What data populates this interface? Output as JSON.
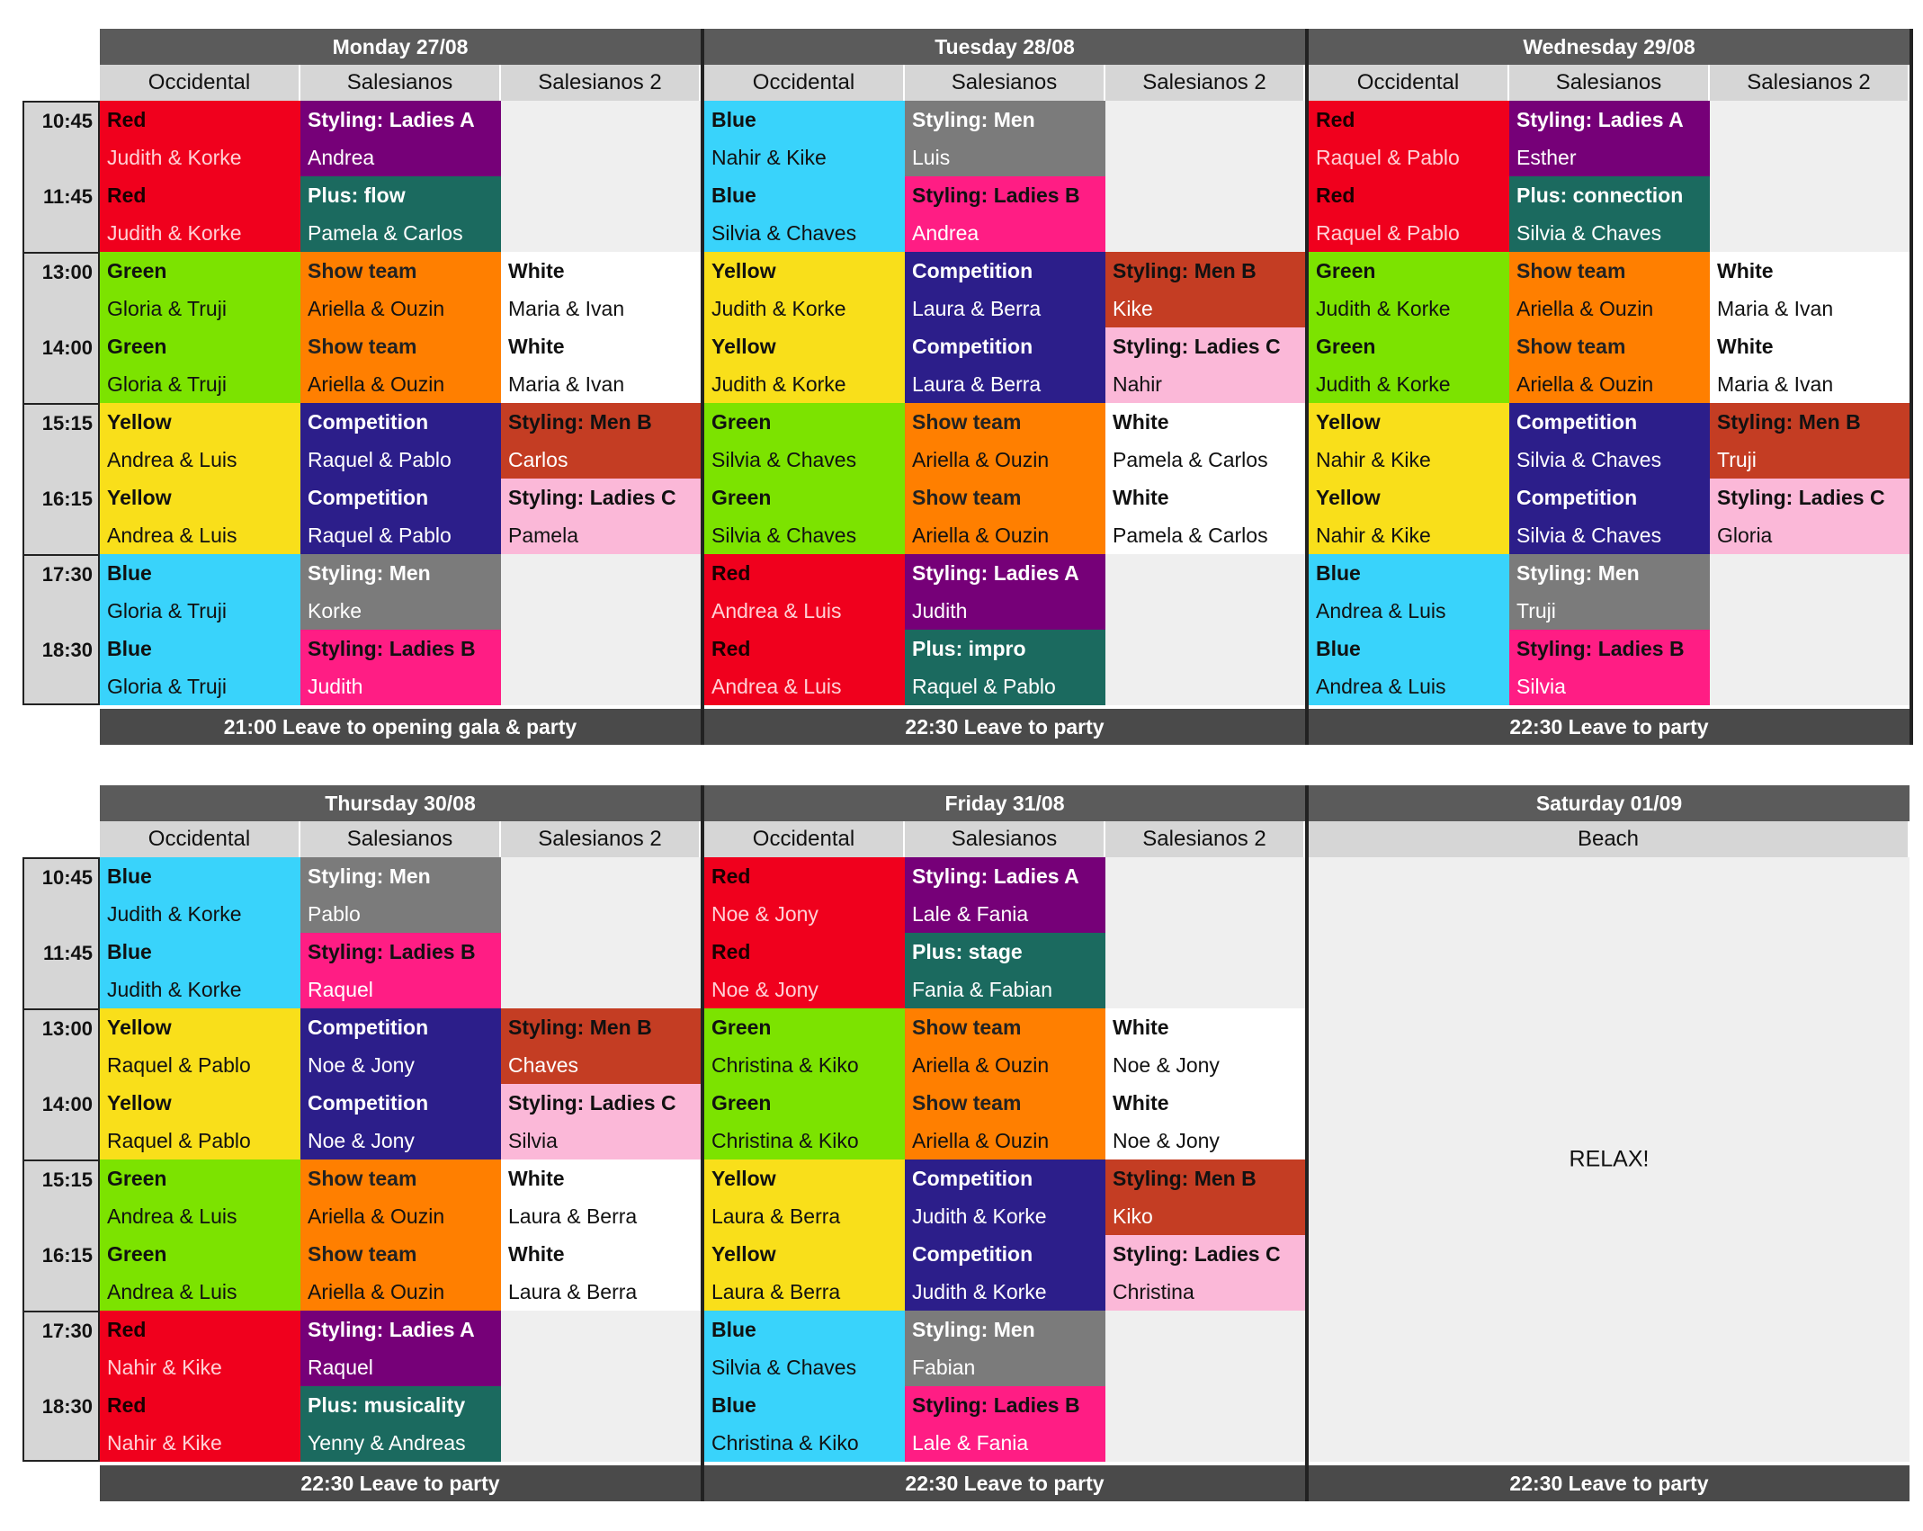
{
  "times": [
    "10:45",
    "11:45",
    "13:00",
    "14:00",
    "15:15",
    "16:15",
    "17:30",
    "18:30"
  ],
  "venues": [
    "Occidental",
    "Salesianos",
    "Salesianos 2"
  ],
  "colors": {
    "Red": "#f0001d",
    "Blue": "#39d3fb",
    "Green": "#7ce300",
    "Yellow": "#f9df1a",
    "Orange": "#ff7f00",
    "Navy": "#2c1e8a",
    "Gray": "#7b7b7b",
    "Purple": "#760078",
    "Teal": "#1b6a5f",
    "Pink": "#ff1d84",
    "LightPink": "#fbb8d8",
    "Brick": "#c43d23",
    "White": "#ffffff"
  },
  "week1": {
    "days": [
      {
        "title": "Monday 27/08",
        "footer": "21:00 Leave to opening gala & party",
        "cols": [
          [
            {
              "c": "Red",
              "t": "Red",
              "p": "Judith & Korke"
            },
            {
              "c": "Red",
              "t": "Red",
              "p": "Judith & Korke"
            },
            {
              "c": "Green",
              "t": "Green",
              "p": "Gloria & Truji"
            },
            {
              "c": "Green",
              "t": "Green",
              "p": "Gloria & Truji"
            },
            {
              "c": "Yellow",
              "t": "Yellow",
              "p": "Andrea & Luis"
            },
            {
              "c": "Yellow",
              "t": "Yellow",
              "p": "Andrea & Luis"
            },
            {
              "c": "Blue",
              "t": "Blue",
              "p": "Gloria & Truji"
            },
            {
              "c": "Blue",
              "t": "Blue",
              "p": "Gloria & Truji"
            }
          ],
          [
            {
              "c": "Purple",
              "t": "Styling: Ladies A",
              "p": "Andrea"
            },
            {
              "c": "Teal",
              "t": "Plus: flow",
              "p": "Pamela & Carlos"
            },
            {
              "c": "Orange",
              "t": "Show team",
              "p": "Ariella & Ouzin"
            },
            {
              "c": "Orange",
              "t": "Show team",
              "p": "Ariella & Ouzin"
            },
            {
              "c": "Navy",
              "t": "Competition",
              "p": "Raquel & Pablo"
            },
            {
              "c": "Navy",
              "t": "Competition",
              "p": "Raquel & Pablo"
            },
            {
              "c": "Gray",
              "t": "Styling: Men",
              "p": "Korke"
            },
            {
              "c": "Pink",
              "t": "Styling: Ladies B",
              "p": "Judith"
            }
          ],
          [
            null,
            null,
            {
              "c": "White",
              "t": "White",
              "p": "Maria & Ivan"
            },
            {
              "c": "White",
              "t": "White",
              "p": "Maria & Ivan"
            },
            {
              "c": "Brick",
              "t": "Styling: Men B",
              "p": "Carlos"
            },
            {
              "c": "LightPink",
              "t": "Styling: Ladies C",
              "p": "Pamela"
            },
            null,
            null
          ]
        ]
      },
      {
        "title": "Tuesday 28/08",
        "footer": "22:30 Leave to party",
        "cols": [
          [
            {
              "c": "Blue",
              "t": "Blue",
              "p": "Nahir & Kike"
            },
            {
              "c": "Blue",
              "t": "Blue",
              "p": "Silvia & Chaves"
            },
            {
              "c": "Yellow",
              "t": "Yellow",
              "p": "Judith & Korke"
            },
            {
              "c": "Yellow",
              "t": "Yellow",
              "p": "Judith & Korke"
            },
            {
              "c": "Green",
              "t": "Green",
              "p": "Silvia & Chaves"
            },
            {
              "c": "Green",
              "t": "Green",
              "p": "Silvia & Chaves"
            },
            {
              "c": "Red",
              "t": "Red",
              "p": "Andrea & Luis"
            },
            {
              "c": "Red",
              "t": "Red",
              "p": "Andrea & Luis"
            }
          ],
          [
            {
              "c": "Gray",
              "t": "Styling: Men",
              "p": "Luis"
            },
            {
              "c": "Pink",
              "t": "Styling: Ladies B",
              "p": "Andrea"
            },
            {
              "c": "Navy",
              "t": "Competition",
              "p": "Laura & Berra"
            },
            {
              "c": "Navy",
              "t": "Competition",
              "p": "Laura & Berra"
            },
            {
              "c": "Orange",
              "t": "Show team",
              "p": "Ariella & Ouzin"
            },
            {
              "c": "Orange",
              "t": "Show team",
              "p": "Ariella & Ouzin"
            },
            {
              "c": "Purple",
              "t": "Styling: Ladies A",
              "p": "Judith"
            },
            {
              "c": "Teal",
              "t": "Plus: impro",
              "p": "Raquel & Pablo"
            }
          ],
          [
            null,
            null,
            {
              "c": "Brick",
              "t": "Styling: Men B",
              "p": "Kike"
            },
            {
              "c": "LightPink",
              "t": "Styling: Ladies C",
              "p": "Nahir"
            },
            {
              "c": "White",
              "t": "White",
              "p": "Pamela & Carlos"
            },
            {
              "c": "White",
              "t": "White",
              "p": "Pamela & Carlos"
            },
            null,
            null
          ]
        ]
      },
      {
        "title": "Wednesday 29/08",
        "footer": "22:30 Leave to party",
        "cols": [
          [
            {
              "c": "Red",
              "t": "Red",
              "p": "Raquel & Pablo"
            },
            {
              "c": "Red",
              "t": "Red",
              "p": "Raquel & Pablo"
            },
            {
              "c": "Green",
              "t": "Green",
              "p": "Judith & Korke"
            },
            {
              "c": "Green",
              "t": "Green",
              "p": "Judith & Korke"
            },
            {
              "c": "Yellow",
              "t": "Yellow",
              "p": "Nahir & Kike"
            },
            {
              "c": "Yellow",
              "t": "Yellow",
              "p": "Nahir & Kike"
            },
            {
              "c": "Blue",
              "t": "Blue",
              "p": "Andrea & Luis"
            },
            {
              "c": "Blue",
              "t": "Blue",
              "p": "Andrea & Luis"
            }
          ],
          [
            {
              "c": "Purple",
              "t": "Styling: Ladies A",
              "p": "Esther"
            },
            {
              "c": "Teal",
              "t": "Plus: connection",
              "p": "Silvia & Chaves"
            },
            {
              "c": "Orange",
              "t": "Show team",
              "p": "Ariella & Ouzin"
            },
            {
              "c": "Orange",
              "t": "Show team",
              "p": "Ariella & Ouzin"
            },
            {
              "c": "Navy",
              "t": "Competition",
              "p": "Silvia & Chaves"
            },
            {
              "c": "Navy",
              "t": "Competition",
              "p": "Silvia & Chaves"
            },
            {
              "c": "Gray",
              "t": "Styling: Men",
              "p": "Truji"
            },
            {
              "c": "Pink",
              "t": "Styling: Ladies B",
              "p": "Silvia"
            }
          ],
          [
            null,
            null,
            {
              "c": "White",
              "t": "White",
              "p": "Maria & Ivan"
            },
            {
              "c": "White",
              "t": "White",
              "p": "Maria & Ivan"
            },
            {
              "c": "Brick",
              "t": "Styling: Men B",
              "p": "Truji"
            },
            {
              "c": "LightPink",
              "t": "Styling: Ladies C",
              "p": "Gloria"
            },
            null,
            null
          ]
        ]
      }
    ]
  },
  "week2": {
    "days": [
      {
        "title": "Thursday 30/08",
        "footer": "22:30 Leave to party",
        "cols": [
          [
            {
              "c": "Blue",
              "t": "Blue",
              "p": "Judith & Korke"
            },
            {
              "c": "Blue",
              "t": "Blue",
              "p": "Judith & Korke"
            },
            {
              "c": "Yellow",
              "t": "Yellow",
              "p": "Raquel & Pablo"
            },
            {
              "c": "Yellow",
              "t": "Yellow",
              "p": "Raquel & Pablo"
            },
            {
              "c": "Green",
              "t": "Green",
              "p": "Andrea & Luis"
            },
            {
              "c": "Green",
              "t": "Green",
              "p": "Andrea & Luis"
            },
            {
              "c": "Red",
              "t": "Red",
              "p": "Nahir & Kike"
            },
            {
              "c": "Red",
              "t": "Red",
              "p": "Nahir & Kike"
            }
          ],
          [
            {
              "c": "Gray",
              "t": "Styling: Men",
              "p": "Pablo"
            },
            {
              "c": "Pink",
              "t": "Styling: Ladies B",
              "p": "Raquel"
            },
            {
              "c": "Navy",
              "t": "Competition",
              "p": "Noe & Jony"
            },
            {
              "c": "Navy",
              "t": "Competition",
              "p": "Noe & Jony"
            },
            {
              "c": "Orange",
              "t": "Show team",
              "p": "Ariella & Ouzin"
            },
            {
              "c": "Orange",
              "t": "Show team",
              "p": "Ariella & Ouzin"
            },
            {
              "c": "Purple",
              "t": "Styling: Ladies A",
              "p": "Raquel"
            },
            {
              "c": "Teal",
              "t": "Plus: musicality",
              "p": "Yenny & Andreas"
            }
          ],
          [
            null,
            null,
            {
              "c": "Brick",
              "t": "Styling: Men B",
              "p": "Chaves"
            },
            {
              "c": "LightPink",
              "t": "Styling: Ladies C",
              "p": "Silvia"
            },
            {
              "c": "White",
              "t": "White",
              "p": "Laura & Berra"
            },
            {
              "c": "White",
              "t": "White",
              "p": "Laura & Berra"
            },
            null,
            null
          ]
        ]
      },
      {
        "title": "Friday 31/08",
        "footer": "22:30 Leave to party",
        "cols": [
          [
            {
              "c": "Red",
              "t": "Red",
              "p": "Noe & Jony"
            },
            {
              "c": "Red",
              "t": "Red",
              "p": "Noe & Jony"
            },
            {
              "c": "Green",
              "t": "Green",
              "p": "Christina & Kiko"
            },
            {
              "c": "Green",
              "t": "Green",
              "p": "Christina & Kiko"
            },
            {
              "c": "Yellow",
              "t": "Yellow",
              "p": "Laura & Berra"
            },
            {
              "c": "Yellow",
              "t": "Yellow",
              "p": "Laura & Berra"
            },
            {
              "c": "Blue",
              "t": "Blue",
              "p": "Silvia & Chaves"
            },
            {
              "c": "Blue",
              "t": "Blue",
              "p": "Christina & Kiko"
            }
          ],
          [
            {
              "c": "Purple",
              "t": "Styling: Ladies A",
              "p": "Lale & Fania"
            },
            {
              "c": "Teal",
              "t": "Plus: stage",
              "p": "Fania & Fabian"
            },
            {
              "c": "Orange",
              "t": "Show team",
              "p": "Ariella & Ouzin"
            },
            {
              "c": "Orange",
              "t": "Show team",
              "p": "Ariella & Ouzin"
            },
            {
              "c": "Navy",
              "t": "Competition",
              "p": "Judith & Korke"
            },
            {
              "c": "Navy",
              "t": "Competition",
              "p": "Judith & Korke"
            },
            {
              "c": "Gray",
              "t": "Styling: Men",
              "p": "Fabian"
            },
            {
              "c": "Pink",
              "t": "Styling: Ladies B",
              "p": "Lale & Fania"
            }
          ],
          [
            null,
            null,
            {
              "c": "White",
              "t": "White",
              "p": "Noe & Jony"
            },
            {
              "c": "White",
              "t": "White",
              "p": "Noe & Jony"
            },
            {
              "c": "Brick",
              "t": "Styling: Men B",
              "p": "Kiko"
            },
            {
              "c": "LightPink",
              "t": "Styling: Ladies C",
              "p": "Christina"
            },
            null,
            null
          ]
        ]
      }
    ],
    "saturday": {
      "title": "Saturday 01/09",
      "venue": "Beach",
      "text": "RELAX!",
      "footer": "22:30 Leave to party"
    }
  }
}
